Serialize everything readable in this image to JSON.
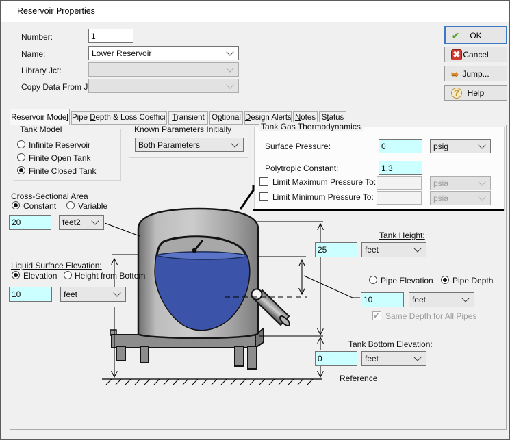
{
  "window": {
    "title": "Reservoir Properties"
  },
  "form": {
    "number": {
      "label": "Number:",
      "value": "1"
    },
    "name": {
      "label": "Name:",
      "value": "Lower Reservoir"
    },
    "library": {
      "label": "Library Jct:",
      "value": ""
    },
    "copy_data": {
      "label": "Copy Data From Jct...",
      "value": ""
    }
  },
  "buttons": {
    "ok": {
      "label": "OK",
      "icon": "green-check-icon"
    },
    "cancel": {
      "label": "Cancel",
      "icon": "red-x-icon"
    },
    "jump": {
      "label": "Jump...",
      "icon": "orange-jump-arrow-icon"
    },
    "help": {
      "label": "Help",
      "icon": "gold-question-icon"
    }
  },
  "tabs": [
    {
      "pre": "Reservoir Mode",
      "key": "l",
      "post": "",
      "active": true
    },
    {
      "pre": "Pipe ",
      "key": "D",
      "post": "epth & Loss Coefficients",
      "active": false
    },
    {
      "pre": "",
      "key": "T",
      "post": "ransient",
      "active": false
    },
    {
      "pre": "O",
      "key": "p",
      "post": "tional",
      "active": false
    },
    {
      "pre": "",
      "key": "D",
      "post": "esign Alerts",
      "active": false
    },
    {
      "pre": "",
      "key": "N",
      "post": "otes",
      "active": false
    },
    {
      "pre": "S",
      "key": "t",
      "post": "atus",
      "active": false
    }
  ],
  "panel": {
    "tank_model": {
      "title": "Tank Model",
      "options": [
        "Infinite Reservoir",
        "Finite Open Tank",
        "Finite Closed Tank"
      ],
      "selected": "Finite Closed Tank"
    },
    "known_params": {
      "title": "Known Parameters Initially",
      "value": "Both Parameters"
    },
    "gas": {
      "title": "Tank Gas Thermodynamics",
      "surface": {
        "label": "Surface Pressure:",
        "value": "0",
        "unit": "psig"
      },
      "poly": {
        "label": "Polytropic Constant:",
        "value": "1.3"
      },
      "limit_max": {
        "label": "Limit Maximum Pressure To:",
        "checked": false,
        "value": "",
        "unit": "psia"
      },
      "limit_min": {
        "label": "Limit Minimum Pressure To:",
        "checked": false,
        "value": "",
        "unit": "psia"
      }
    },
    "csa": {
      "title": "Cross-Sectional Area",
      "options": [
        "Constant",
        "Variable"
      ],
      "selected": "Constant",
      "value": "20",
      "unit": "feet2"
    },
    "lse": {
      "title": "Liquid Surface Elevation:",
      "options": [
        "Elevation",
        "Height from Bottom"
      ],
      "selected": "Elevation",
      "value": "10",
      "unit": "feet"
    },
    "tank_height": {
      "label": "Tank Height:",
      "value": "25",
      "unit": "feet"
    },
    "pipe": {
      "opt_elevation": "Pipe Elevation",
      "opt_depth": "Pipe Depth",
      "selected": "Pipe Depth",
      "value": "10",
      "unit": "feet",
      "same_label": "Same Depth for All Pipes",
      "same_checked": true
    },
    "tank_bottom": {
      "label": "Tank Bottom Elevation:",
      "value": "0",
      "unit": "feet"
    },
    "reference": "Reference"
  },
  "colors": {
    "input_highlight": "#ccffff",
    "ok_focus_border": "#3c78c3",
    "check_green": "#53a231",
    "cancel_red": "#cf3b30",
    "jump_orange": "#e0892c",
    "help_gold": "#c7901f",
    "liquid_blue": "#3b54a9",
    "dialog_bg": "#f0f0f0"
  }
}
